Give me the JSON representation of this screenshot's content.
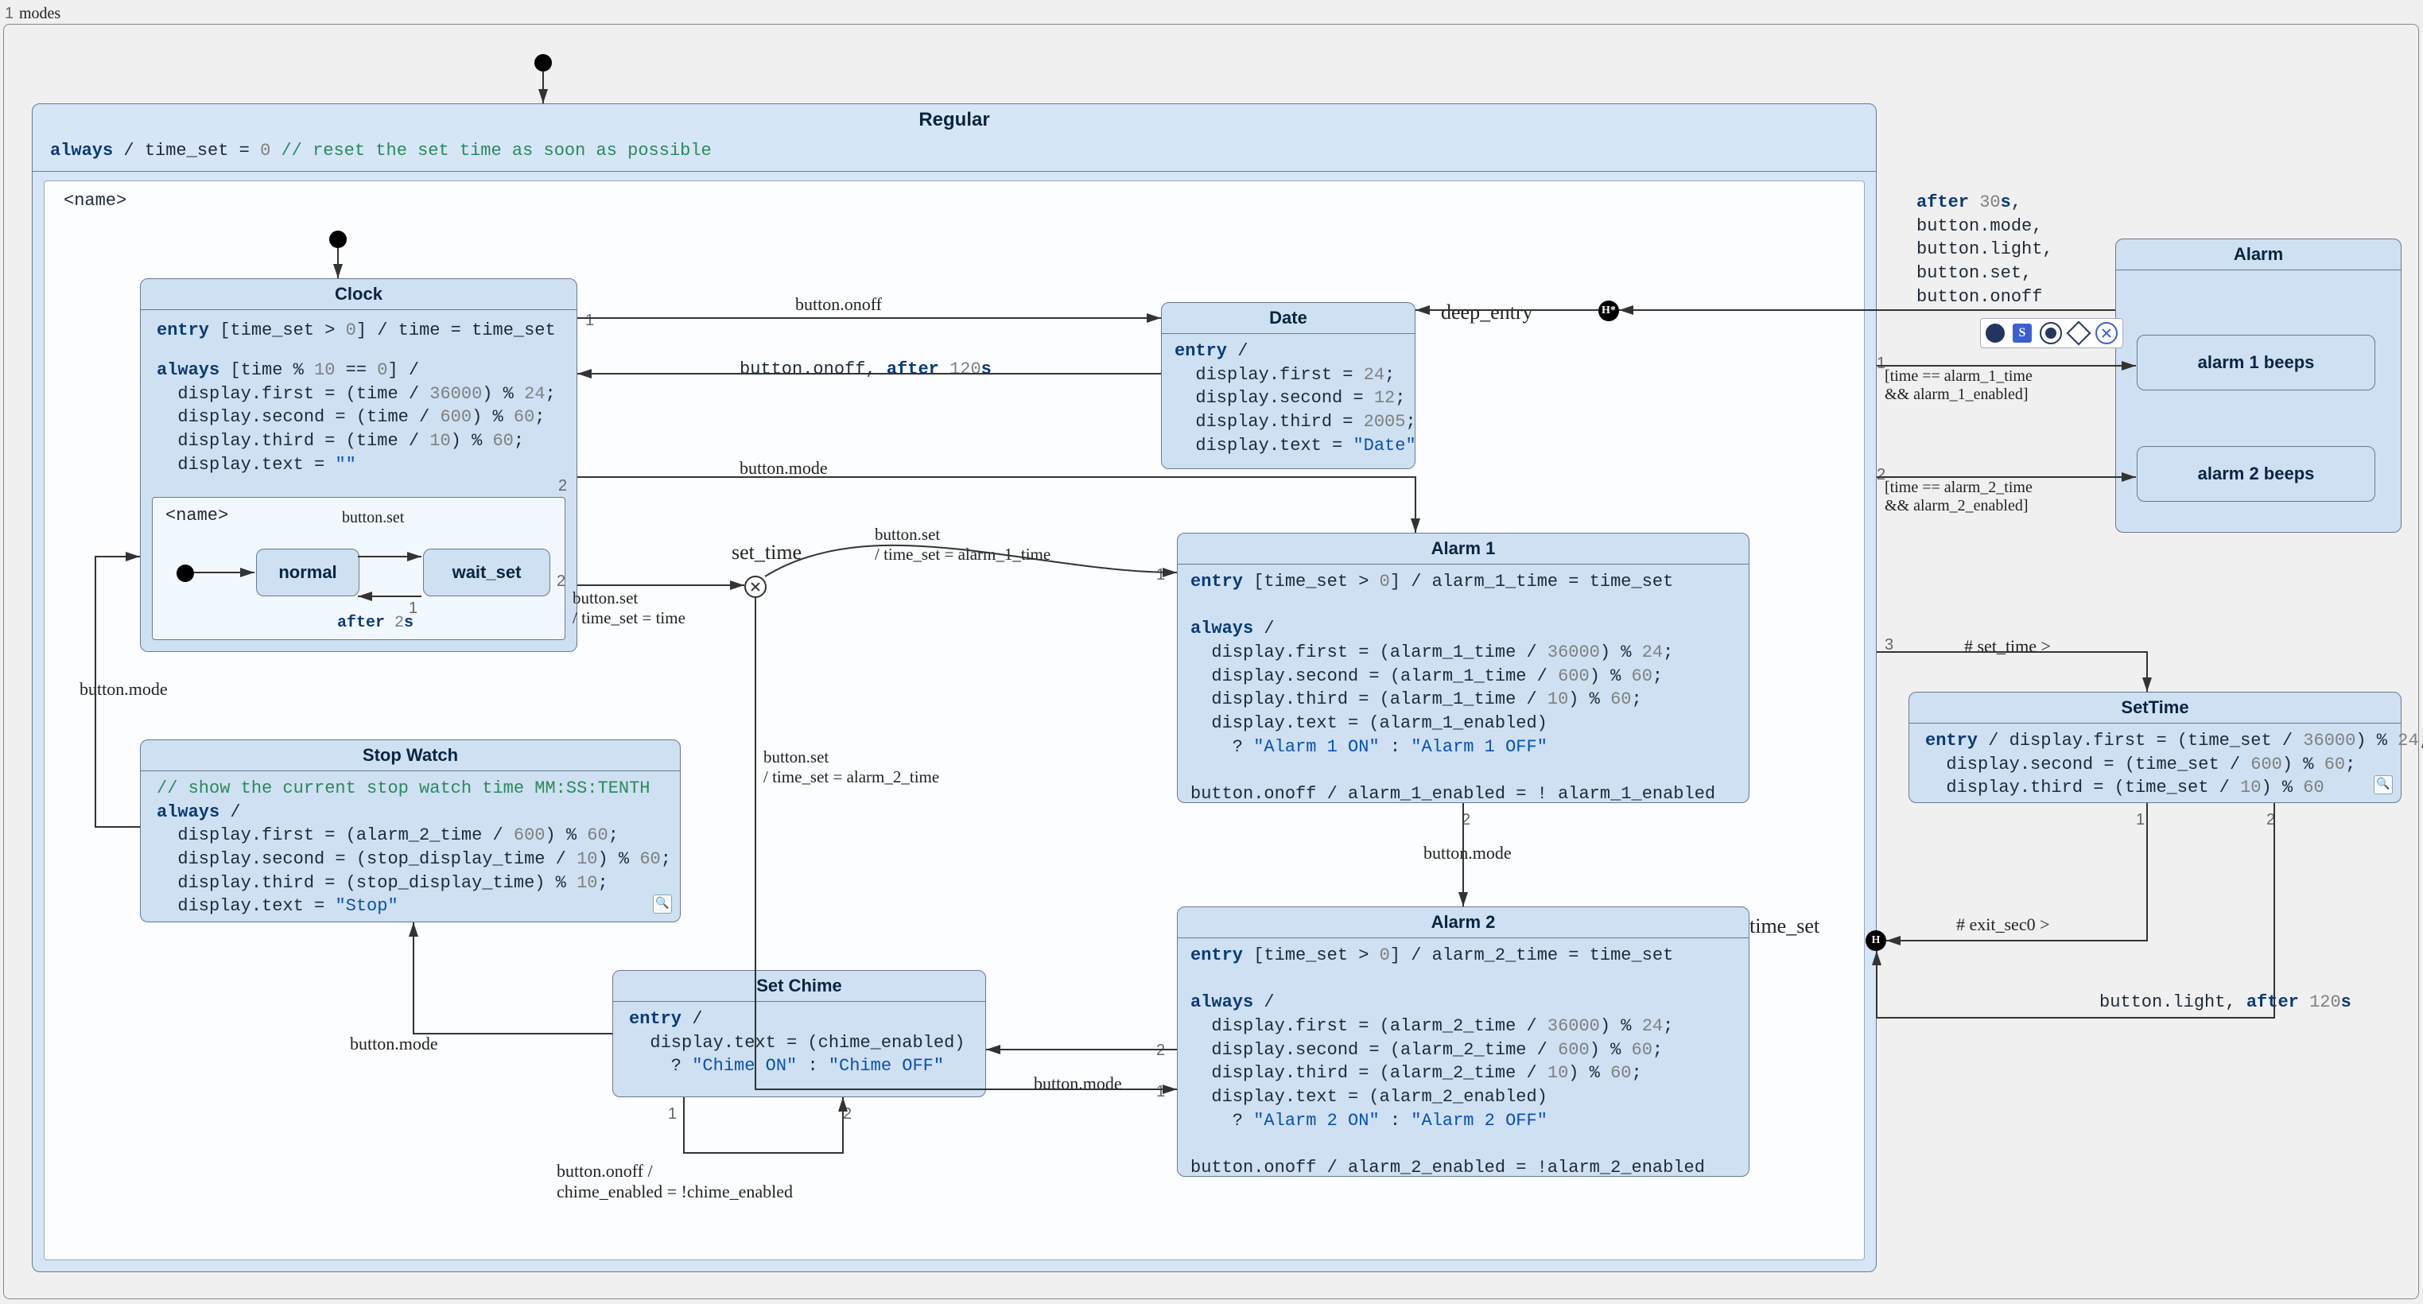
{
  "modes_label": "modes",
  "modes_num": "1",
  "regular": {
    "title": "Regular",
    "always_line": "always / time_set = 0 // reset the set time as soon as possible",
    "name_placeholder": "<name>"
  },
  "clock": {
    "title": "Clock",
    "entry": "entry [time_set > 0] / time = time_set",
    "always": "always [time % 10 == 0] /\n  display.first = (time / 36000) % 24;\n  display.second = (time / 600) % 60;\n  display.third = (time / 10) % 60;\n  display.text = \"\"",
    "inner_name": "<name>",
    "normal": "normal",
    "wait_set": "wait_set"
  },
  "date": {
    "title": "Date",
    "body": "entry /\n  display.first = 24;\n  display.second = 12;\n  display.third = 2005;\n  display.text = \"Date\""
  },
  "alarm1": {
    "title": "Alarm 1",
    "body": "entry [time_set > 0] / alarm_1_time = time_set\n\nalways /\n  display.first = (alarm_1_time / 36000) % 24;\n  display.second = (alarm_1_time / 600) % 60;\n  display.third = (alarm_1_time / 10) % 60;\n  display.text = (alarm_1_enabled)\n    ? \"Alarm 1 ON\" : \"Alarm 1 OFF\"\n\nbutton.onoff / alarm_1_enabled = ! alarm_1_enabled"
  },
  "alarm2": {
    "title": "Alarm 2",
    "body": "entry [time_set > 0] / alarm_2_time = time_set\n\nalways /\n  display.first = (alarm_2_time / 36000) % 24;\n  display.second = (alarm_2_time / 600) % 60;\n  display.third = (alarm_2_time / 10) % 60;\n  display.text = (alarm_2_enabled)\n    ? \"Alarm 2 ON\" : \"Alarm 2 OFF\"\n\nbutton.onoff / alarm_2_enabled = !alarm_2_enabled"
  },
  "stopwatch": {
    "title": "Stop Watch",
    "body": "// show the current stop watch time MM:SS:TENTH\nalways /\n  display.first = (alarm_2_time / 600) % 60;\n  display.second = (stop_display_time / 10) % 60;\n  display.third = (stop_display_time) % 10;\n  display.text = \"Stop\""
  },
  "setchime": {
    "title": "Set Chime",
    "body": "entry /\n  display.text = (chime_enabled)\n    ? \"Chime ON\" : \"Chime OFF\""
  },
  "alarm": {
    "title": "Alarm",
    "beep1": "alarm 1 beeps",
    "beep2": "alarm 2 beeps"
  },
  "settime": {
    "title": "SetTime",
    "body": "entry / display.first = (time_set / 36000) % 24;\n  display.second = (time_set / 600) % 60;\n  display.third = (time_set / 10) % 60"
  },
  "edges": {
    "clock_date_onoff": "button.onoff",
    "date_clock": "button.onoff, after 120s",
    "clock_alarm1_mode": "button.mode",
    "clock_waitset_set": "button.set",
    "waitset_normal_after": "after 2s",
    "normal_waitset_label": "button.set",
    "clock_junc": "button.set\n/ time_set = time",
    "set_time_label": "set_time",
    "junc_alarm1": "button.set\n/ time_set = alarm_1_time",
    "junc_alarm2": "button.set\n/ time_set = alarm_2_time",
    "alarm1_alarm2": "button.mode",
    "alarm2_setchime": "button.mode",
    "setchime_stopwatch": "button.mode",
    "stopwatch_clock": "button.mode",
    "chime_self": "button.onoff /\nchime_enabled = !chime_enabled",
    "deep_entry": "deep_entry",
    "alarm_events": "after 30s,\nbutton.mode,\nbutton.light,\nbutton.set,\nbutton.onoff",
    "alarm1_guard": "[time == alarm_1_time\n&& alarm_1_enabled]",
    "alarm2_guard": "[time == alarm_2_time\n&& alarm_2_enabled]",
    "set_time_ref": "# set_time >",
    "exit_sec0": "# exit_sec0 >",
    "time_set_label": "time_set",
    "settime_back": "button.light, after 120s",
    "n1": "1",
    "n2": "2",
    "n3": "3"
  }
}
